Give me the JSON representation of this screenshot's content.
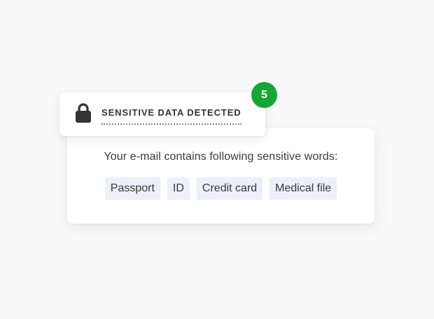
{
  "alert": {
    "title": "SENSITIVE DATA DETECTED",
    "icon": "lock-icon",
    "count": "5"
  },
  "details": {
    "message": "Your e-mail contains following sensitive words:",
    "words": [
      "Passport",
      "ID",
      "Credit card",
      "Medical file"
    ]
  },
  "colors": {
    "background": "#f9f9f9",
    "card": "#ffffff",
    "chip_background": "#eeeffa",
    "badge": "#17a534",
    "text": "#3a3a3a",
    "lock": "#333333"
  }
}
